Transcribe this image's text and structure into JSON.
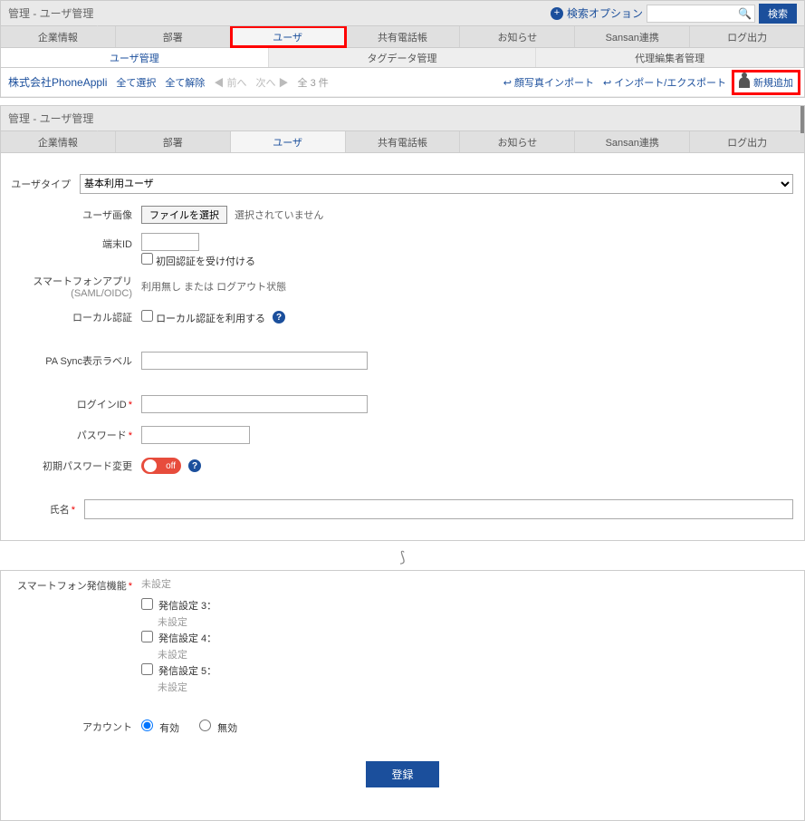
{
  "breadcrumb": {
    "title": "管理 - ユーザ管理"
  },
  "search": {
    "opt_label": "検索オプション",
    "button": "検索",
    "placeholder": ""
  },
  "main_tabs": [
    "企業情報",
    "部署",
    "ユーザ",
    "共有電話帳",
    "お知らせ",
    "Sansan連携",
    "ログ出力"
  ],
  "sub_tabs": [
    "ユーザ管理",
    "タグデータ管理",
    "代理編集者管理"
  ],
  "toolbar": {
    "org": "株式会社PhoneAppli",
    "select_all": "全て選択",
    "deselect_all": "全て解除",
    "prev": "前へ",
    "next": "次へ",
    "count": "全 3 件",
    "photo_import": "顔写真インポート",
    "import_export": "インポート/エクスポート",
    "add_new": "新規追加"
  },
  "form": {
    "user_type": {
      "label": "ユーザタイプ",
      "value": "基本利用ユーザ"
    },
    "user_image": {
      "label": "ユーザ画像",
      "button": "ファイルを選択",
      "status": "選択されていません"
    },
    "device_id": {
      "label": "端末ID",
      "checkbox": "初回認証を受け付ける"
    },
    "smart_app": {
      "label": "スマートフォンアプリ",
      "sub": "(SAML/OIDC)",
      "value": "利用無し または ログアウト状態"
    },
    "local_auth": {
      "label": "ローカル認証",
      "checkbox": "ローカル認証を利用する"
    },
    "pa_sync": {
      "label": "PA Sync表示ラベル"
    },
    "login_id": {
      "label": "ログインID"
    },
    "password": {
      "label": "パスワード"
    },
    "init_pw": {
      "label": "初期パスワード変更",
      "toggle": "off"
    },
    "name": {
      "label": "氏名"
    }
  },
  "outgoing": {
    "label": "スマートフォン発信機能",
    "preset": "未設定",
    "items": [
      {
        "cb": "発信設定 3：",
        "sub": "未設定"
      },
      {
        "cb": "発信設定 4：",
        "sub": "未設定"
      },
      {
        "cb": "発信設定 5：",
        "sub": "未設定"
      }
    ]
  },
  "account": {
    "label": "アカウント",
    "valid": "有効",
    "invalid": "無効"
  },
  "submit": "登録"
}
